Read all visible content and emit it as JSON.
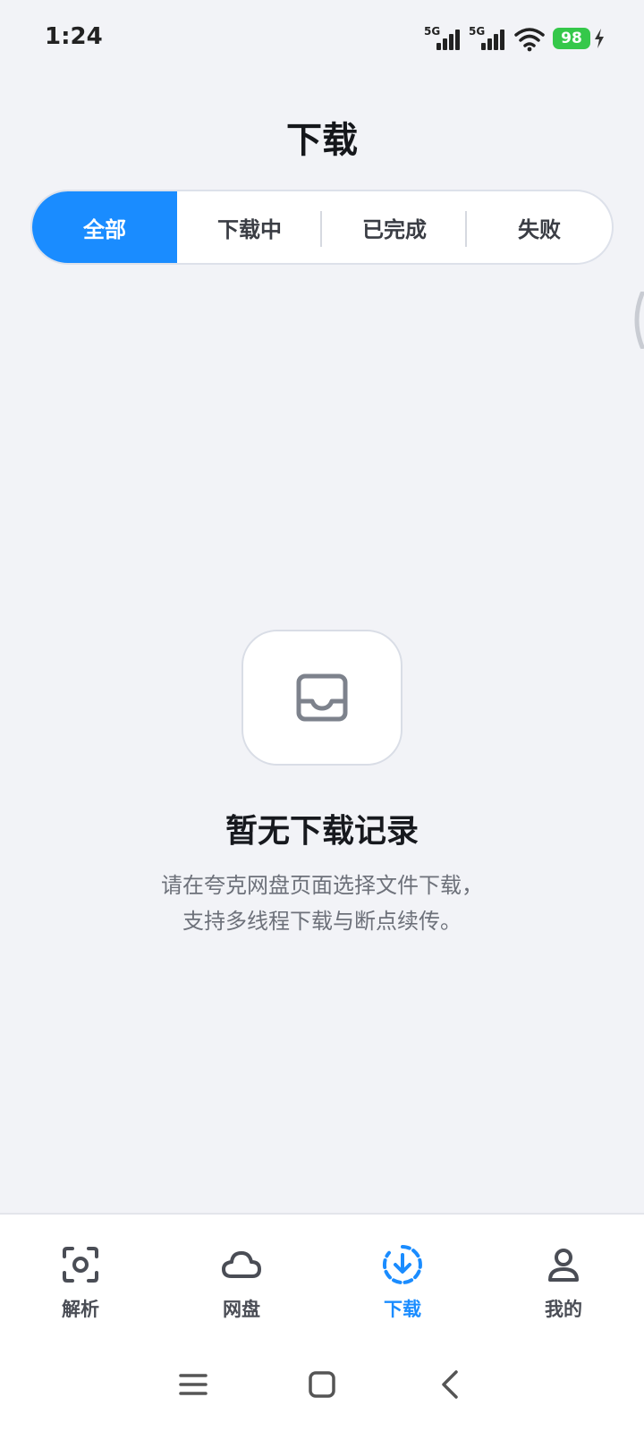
{
  "status_bar": {
    "time": "1:24",
    "sim1_label": "5G",
    "sim2_label": "5G",
    "battery": "98",
    "battery_color": "#35c84a"
  },
  "header": {
    "title": "下载"
  },
  "tabs": [
    {
      "label": "全部",
      "active": true
    },
    {
      "label": "下载中",
      "active": false
    },
    {
      "label": "已完成",
      "active": false
    },
    {
      "label": "失败",
      "active": false
    }
  ],
  "empty_state": {
    "icon": "inbox-icon",
    "title": "暂无下载记录",
    "desc_line1": "请在夸克网盘页面选择文件下载，",
    "desc_line2": "支持多线程下载与断点续传。"
  },
  "bottom_nav": [
    {
      "label": "解析",
      "icon": "scan-icon",
      "active": false
    },
    {
      "label": "网盘",
      "icon": "cloud-icon",
      "active": false
    },
    {
      "label": "下载",
      "icon": "download-icon",
      "active": true
    },
    {
      "label": "我的",
      "icon": "user-icon",
      "active": false
    }
  ],
  "colors": {
    "accent": "#1a8cff",
    "background": "#f2f3f7"
  }
}
